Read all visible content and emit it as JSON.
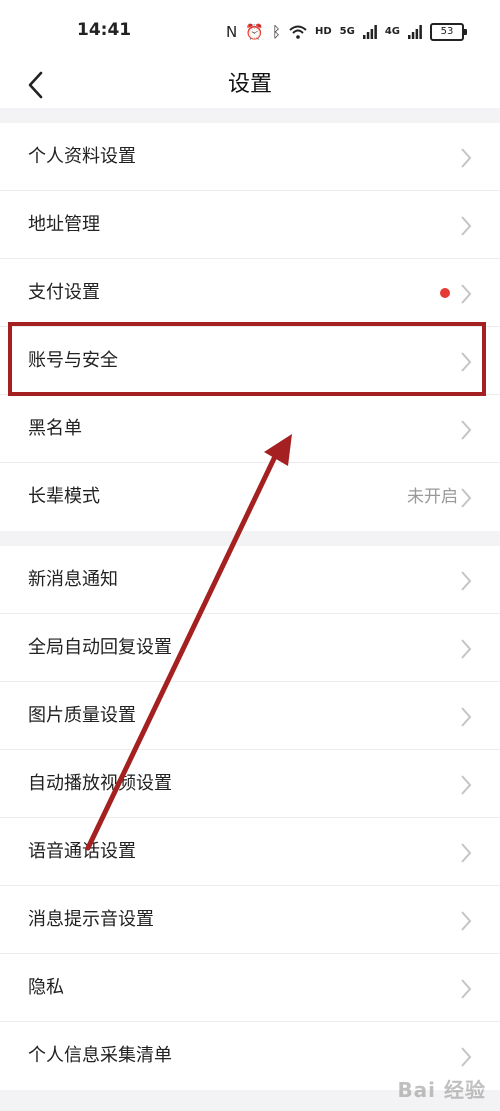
{
  "status_bar": {
    "time": "14:41",
    "icons": [
      "nfc-icon",
      "alarm-icon",
      "bluetooth-icon",
      "wifi-icon",
      "hd-icon",
      "signal-icon",
      "signal-icon"
    ],
    "hd_label": "HD",
    "net1_label": "5G",
    "net2_label": "4G",
    "battery": "53"
  },
  "header": {
    "title": "设置",
    "back_icon": "chevron-left-icon"
  },
  "groups": [
    {
      "items": [
        {
          "label": "个人资料设置"
        },
        {
          "label": "地址管理"
        },
        {
          "label": "支付设置",
          "badge": "red-dot"
        },
        {
          "label": "账号与安全",
          "highlighted": true
        },
        {
          "label": "黑名单"
        },
        {
          "label": "长辈模式",
          "value": "未开启"
        }
      ]
    },
    {
      "items": [
        {
          "label": "新消息通知"
        },
        {
          "label": "全局自动回复设置"
        },
        {
          "label": "图片质量设置"
        },
        {
          "label": "自动播放视频设置"
        },
        {
          "label": "语音通话设置"
        },
        {
          "label": "消息提示音设置"
        },
        {
          "label": "隐私"
        },
        {
          "label": "个人信息采集清单"
        }
      ]
    }
  ],
  "colors": {
    "page_bg": "#f3f3f5",
    "highlight": "#a52020",
    "badge": "#e53935",
    "chevron": "#c4c4c4"
  },
  "watermark": "Bai 经验"
}
